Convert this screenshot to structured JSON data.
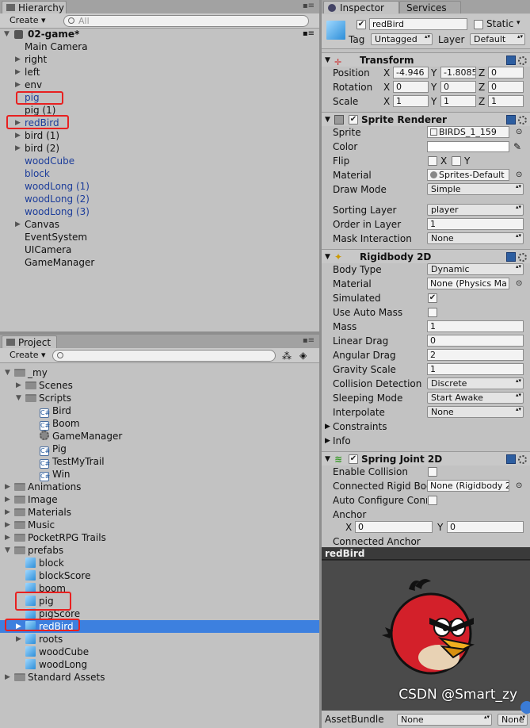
{
  "hierarchy": {
    "tab": "Hierarchy",
    "create_label": "Create",
    "search_placeholder": "All",
    "scene": "02-game*",
    "items": [
      {
        "label": "Main Camera",
        "expandable": false,
        "color": "black"
      },
      {
        "label": "right",
        "expandable": true,
        "color": "black"
      },
      {
        "label": "left",
        "expandable": true,
        "color": "black"
      },
      {
        "label": "env",
        "expandable": true,
        "color": "black"
      },
      {
        "label": "pig",
        "expandable": false,
        "color": "blue"
      },
      {
        "label": "pig (1)",
        "expandable": false,
        "color": "black"
      },
      {
        "label": "redBird",
        "expandable": true,
        "color": "blue"
      },
      {
        "label": "bird (1)",
        "expandable": true,
        "color": "black"
      },
      {
        "label": "bird (2)",
        "expandable": true,
        "color": "black"
      },
      {
        "label": "woodCube",
        "expandable": false,
        "color": "blue"
      },
      {
        "label": "block",
        "expandable": false,
        "color": "blue"
      },
      {
        "label": "woodLong (1)",
        "expandable": false,
        "color": "blue"
      },
      {
        "label": "woodLong (2)",
        "expandable": false,
        "color": "blue"
      },
      {
        "label": "woodLong (3)",
        "expandable": false,
        "color": "blue"
      },
      {
        "label": "Canvas",
        "expandable": true,
        "color": "black"
      },
      {
        "label": "EventSystem",
        "expandable": false,
        "color": "black"
      },
      {
        "label": "UICamera",
        "expandable": false,
        "color": "black"
      },
      {
        "label": "GameManager",
        "expandable": false,
        "color": "black"
      }
    ]
  },
  "project": {
    "tab": "Project",
    "create_label": "Create",
    "items": [
      {
        "label": "_my",
        "type": "folder",
        "indent": 0,
        "expand": "open"
      },
      {
        "label": "Scenes",
        "type": "folder",
        "indent": 1,
        "expand": "closed"
      },
      {
        "label": "Scripts",
        "type": "folder",
        "indent": 1,
        "expand": "open"
      },
      {
        "label": "Bird",
        "type": "script",
        "indent": 2,
        "expand": "none"
      },
      {
        "label": "Boom",
        "type": "script",
        "indent": 2,
        "expand": "none"
      },
      {
        "label": "GameManager",
        "type": "gear",
        "indent": 2,
        "expand": "none"
      },
      {
        "label": "Pig",
        "type": "script",
        "indent": 2,
        "expand": "none"
      },
      {
        "label": "TestMyTrail",
        "type": "script",
        "indent": 2,
        "expand": "none"
      },
      {
        "label": "Win",
        "type": "script",
        "indent": 2,
        "expand": "none"
      },
      {
        "label": "Animations",
        "type": "folder",
        "indent": 0,
        "expand": "closed"
      },
      {
        "label": "Image",
        "type": "folder",
        "indent": 0,
        "expand": "closed"
      },
      {
        "label": "Materials",
        "type": "folder",
        "indent": 0,
        "expand": "closed"
      },
      {
        "label": "Music",
        "type": "folder",
        "indent": 0,
        "expand": "closed"
      },
      {
        "label": "PocketRPG Trails",
        "type": "folder",
        "indent": 0,
        "expand": "closed"
      },
      {
        "label": "prefabs",
        "type": "folder",
        "indent": 0,
        "expand": "open"
      },
      {
        "label": "block",
        "type": "prefab",
        "indent": 1,
        "expand": "none"
      },
      {
        "label": "blockScore",
        "type": "prefab",
        "indent": 1,
        "expand": "none"
      },
      {
        "label": "boom",
        "type": "prefab",
        "indent": 1,
        "expand": "none"
      },
      {
        "label": "pig",
        "type": "prefab",
        "indent": 1,
        "expand": "none"
      },
      {
        "label": "pigScore",
        "type": "prefab",
        "indent": 1,
        "expand": "none"
      },
      {
        "label": "redBird",
        "type": "prefab",
        "indent": 1,
        "expand": "closed",
        "selected": true
      },
      {
        "label": "roots",
        "type": "prefab",
        "indent": 1,
        "expand": "closed"
      },
      {
        "label": "woodCube",
        "type": "prefab",
        "indent": 1,
        "expand": "none"
      },
      {
        "label": "woodLong",
        "type": "prefab",
        "indent": 1,
        "expand": "none"
      },
      {
        "label": "Standard Assets",
        "type": "folder",
        "indent": 0,
        "expand": "closed"
      }
    ]
  },
  "inspector": {
    "tab": "Inspector",
    "tab2": "Services",
    "object_name": "redBird",
    "static_label": "Static",
    "tag_label": "Tag",
    "tag_value": "Untagged",
    "layer_label": "Layer",
    "layer_value": "Default",
    "transform": {
      "title": "Transform",
      "position_label": "Position",
      "position": [
        "-4.946",
        "-1.8085",
        "0"
      ],
      "rotation_label": "Rotation",
      "rotation": [
        "0",
        "0",
        "0"
      ],
      "scale_label": "Scale",
      "scale": [
        "1",
        "1",
        "1"
      ],
      "x": "X",
      "y": "Y",
      "z": "Z"
    },
    "sprite_renderer": {
      "title": "Sprite Renderer",
      "sprite_label": "Sprite",
      "sprite": "BIRDS_1_159",
      "color_label": "Color",
      "flip_label": "Flip",
      "flip_x": "X",
      "flip_y": "Y",
      "material_label": "Material",
      "material": "Sprites-Default",
      "draw_mode_label": "Draw Mode",
      "draw_mode": "Simple",
      "sorting_layer_label": "Sorting Layer",
      "sorting_layer": "player",
      "order_label": "Order in Layer",
      "order": "1",
      "mask_label": "Mask Interaction",
      "mask": "None"
    },
    "rigidbody": {
      "title": "Rigidbody 2D",
      "body_type_label": "Body Type",
      "body_type": "Dynamic",
      "material_label": "Material",
      "material": "None (Physics Ma",
      "simulated_label": "Simulated",
      "auto_mass_label": "Use Auto Mass",
      "mass_label": "Mass",
      "mass": "1",
      "linear_drag_label": "Linear Drag",
      "linear_drag": "0",
      "angular_drag_label": "Angular Drag",
      "angular_drag": "2",
      "gravity_label": "Gravity Scale",
      "gravity": "1",
      "collision_label": "Collision Detection",
      "collision": "Discrete",
      "sleeping_label": "Sleeping Mode",
      "sleeping": "Start Awake",
      "interpolate_label": "Interpolate",
      "interpolate": "None",
      "constraints_label": "Constraints",
      "info_label": "Info"
    },
    "spring": {
      "title": "Spring Joint 2D",
      "enable_collision_label": "Enable Collision",
      "connected_label": "Connected Rigid Boc",
      "connected": "None (Rigidbody 2",
      "auto_conf_label": "Auto Configure Conr",
      "anchor_label": "Anchor",
      "anchor_x": "0",
      "anchor_y": "0",
      "connected_anchor_label": "Connected Anchor"
    },
    "preview_title": "redBird",
    "asset_bundle_label": "AssetBundle",
    "asset_bundle_value": "None",
    "asset_bundle_variant": "None"
  },
  "watermark": "CSDN @Smart_zy",
  "colors": {
    "selection": "#3d80df",
    "highlight_box": "#e82020",
    "prefab_blue": "#1d3d9a",
    "panel_bg": "#c2c2c2"
  }
}
